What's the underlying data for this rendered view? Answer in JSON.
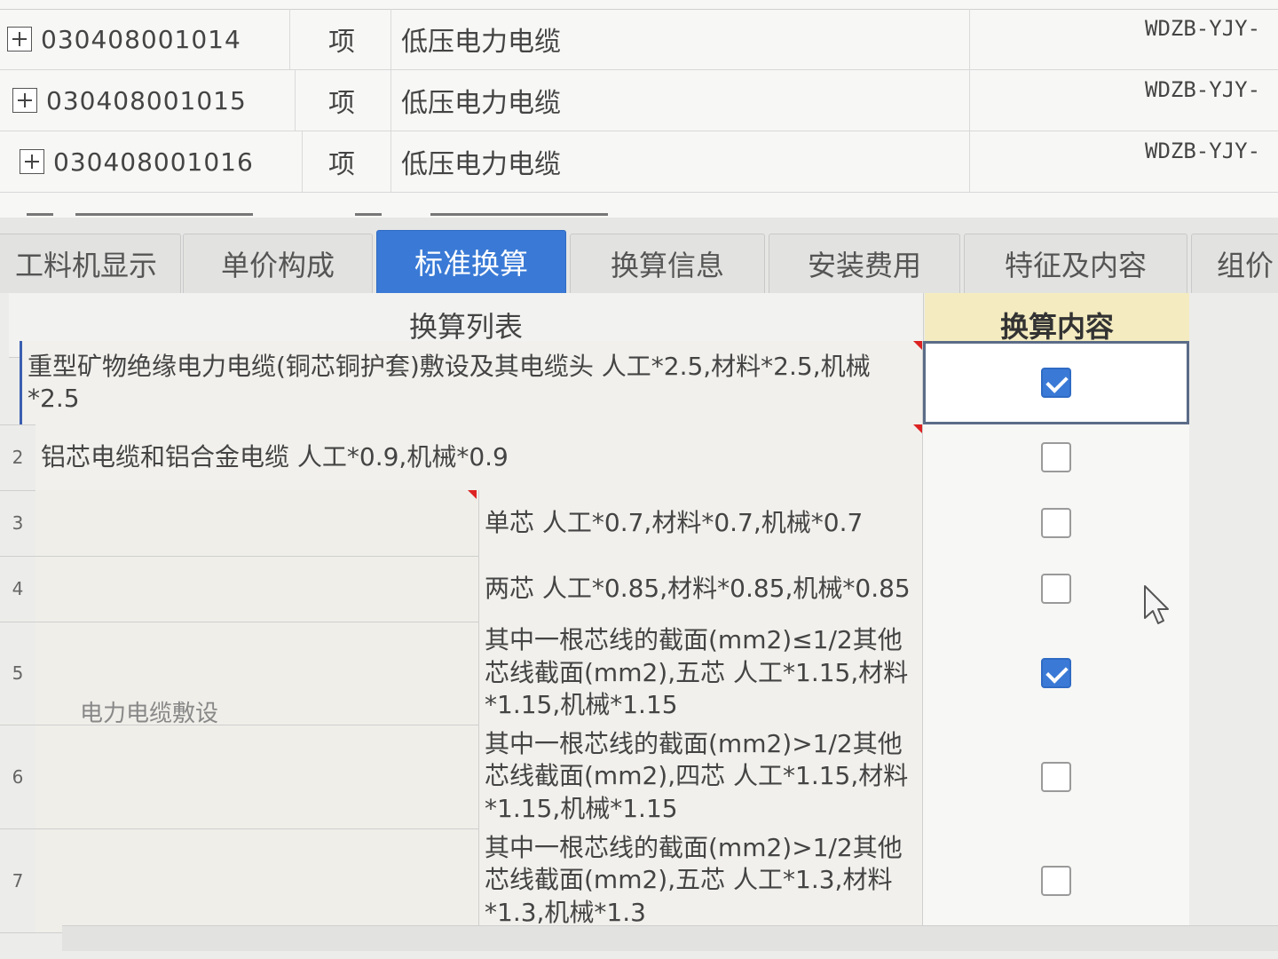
{
  "top_rows": [
    {
      "code": "030408001014",
      "unit": "项",
      "name": "低压电力电缆",
      "spec": "WDZB-YJY-"
    },
    {
      "code": "030408001015",
      "unit": "项",
      "name": "低压电力电缆",
      "spec": "WDZB-YJY-"
    },
    {
      "code": "030408001016",
      "unit": "项",
      "name": "低压电力电缆",
      "spec": "WDZB-YJY-"
    }
  ],
  "tabs": [
    {
      "label": "工料机显示",
      "active": false
    },
    {
      "label": "单价构成",
      "active": false
    },
    {
      "label": "标准换算",
      "active": true
    },
    {
      "label": "换算信息",
      "active": false
    },
    {
      "label": "安装费用",
      "active": false
    },
    {
      "label": "特征及内容",
      "active": false
    },
    {
      "label": "组价",
      "active": false
    }
  ],
  "table": {
    "header_list": "换算列表",
    "header_content": "换算内容",
    "group_label": "电力电缆敷设",
    "rows": [
      {
        "num": "",
        "text": "重型矿物绝缘电力电缆(铜芯铜护套)敷设及其电缆头 人工*2.5,材料*2.5,机械*2.5",
        "checked": true
      },
      {
        "num": "2",
        "text": "铝芯电缆和铝合金电缆 人工*0.9,机械*0.9",
        "checked": false
      },
      {
        "num": "3",
        "text": "单芯 人工*0.7,材料*0.7,机械*0.7",
        "checked": false
      },
      {
        "num": "4",
        "text": "两芯 人工*0.85,材料*0.85,机械*0.85",
        "checked": false
      },
      {
        "num": "5",
        "text": "其中一根芯线的截面(mm2)≤1/2其他芯线截面(mm2),五芯 人工*1.15,材料*1.15,机械*1.15",
        "checked": true
      },
      {
        "num": "6",
        "text": "其中一根芯线的截面(mm2)>1/2其他芯线截面(mm2),四芯 人工*1.15,材料*1.15,机械*1.15",
        "checked": false
      },
      {
        "num": "7",
        "text": "其中一根芯线的截面(mm2)>1/2其他芯线截面(mm2),五芯 人工*1.3,材料*1.3,机械*1.3",
        "checked": false
      }
    ]
  },
  "colors": {
    "accent": "#3a7ad6",
    "header_content_bg": "#f4ecc0"
  }
}
